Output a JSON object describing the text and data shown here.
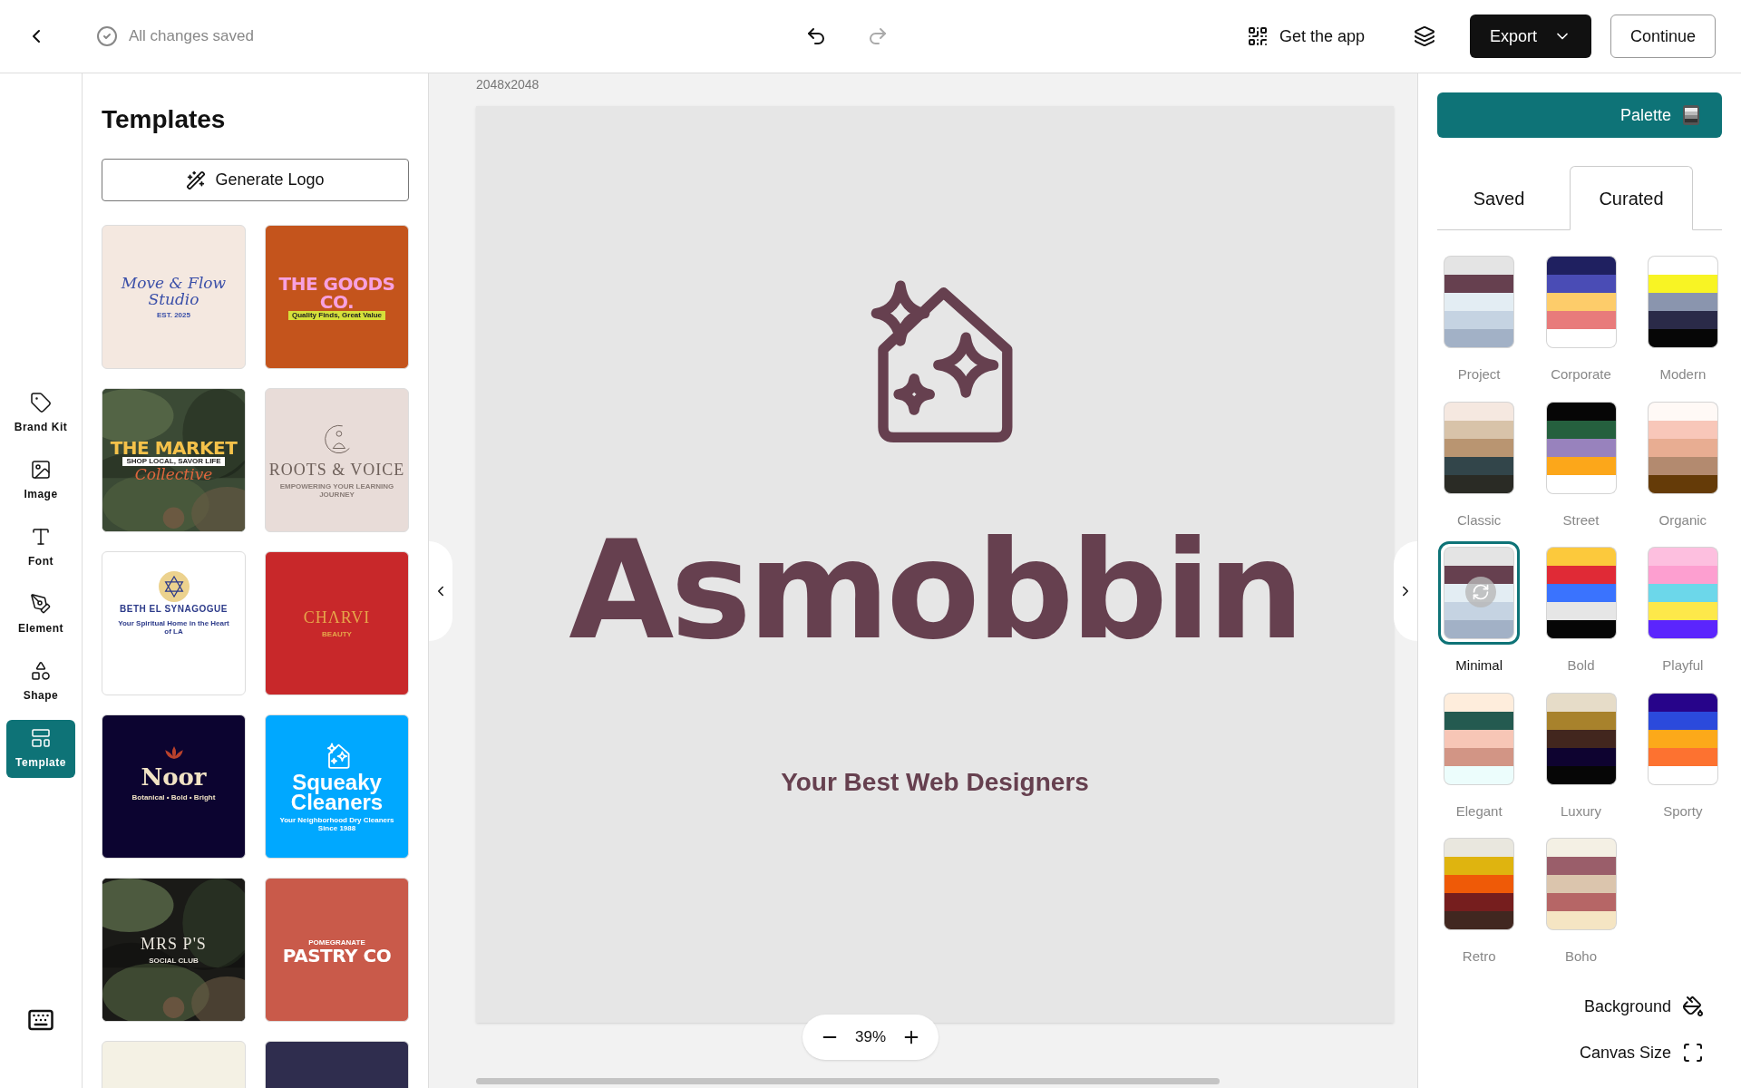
{
  "top_bar": {
    "save_status": "All changes saved",
    "redo_disabled": true,
    "get_app": "Get the app",
    "export": "Export",
    "continue": "Continue"
  },
  "tool_rail": [
    {
      "label": "Brand Kit",
      "selected": false
    },
    {
      "label": "Image",
      "selected": false
    },
    {
      "label": "Font",
      "selected": false
    },
    {
      "label": "Element",
      "selected": false
    },
    {
      "label": "Shape",
      "selected": false
    },
    {
      "label": "Template",
      "selected": true
    }
  ],
  "templates_panel": {
    "title": "Templates",
    "generate_button": "Generate Logo",
    "tiles": [
      {
        "color": "#f4e8e0",
        "lines": [
          {
            "kind": "script",
            "text": "Move & Flow Studio",
            "color": "#3a4fa8"
          },
          {
            "kind": "caption",
            "text": "EST. 2025",
            "color": "#3a4fa8"
          }
        ]
      },
      {
        "color": "#c4541c",
        "lines": [
          {
            "kind": "display",
            "text": "THE GOODS CO.",
            "color": "#f7a1e0"
          },
          {
            "kind": "tag",
            "text": "Quality Finds, Great Value",
            "color": "#d6e03a"
          }
        ]
      },
      {
        "color": "#3b4a35",
        "kind": "picture",
        "lines": [
          {
            "kind": "display",
            "text": "THE MARKET",
            "color": "#f5c24a"
          },
          {
            "kind": "tag",
            "text": "SHOP LOCAL, SAVOR LIFE",
            "color": "#ffffff"
          },
          {
            "kind": "script",
            "text": "Collective",
            "color": "#e0663d"
          }
        ]
      },
      {
        "color": "#e8dcd8",
        "lines": [
          {
            "kind": "serif",
            "text": "ROOTS & VOICE",
            "color": "#6e605a"
          },
          {
            "kind": "caption",
            "text": "EMPOWERING YOUR LEARNING JOURNEY",
            "color": "#8a7d78"
          }
        ]
      },
      {
        "color": "#ffffff",
        "lines": [
          {
            "kind": "heading",
            "text": "BETH EL SYNAGOGUE",
            "color": "#2d3b8a"
          },
          {
            "kind": "caption",
            "text": "Your Spiritual Home in the Heart of LA",
            "color": "#2d3b8a"
          }
        ]
      },
      {
        "color": "#c8282a",
        "lines": [
          {
            "kind": "serif",
            "text": "CHΛRVI",
            "color": "#e6a64a"
          },
          {
            "kind": "caption",
            "text": "BEAUTY",
            "color": "#e6a64a"
          }
        ]
      },
      {
        "color": "#0c0430",
        "lines": [
          {
            "kind": "serif-bold",
            "text": "Noor",
            "color": "#f1e3c4"
          },
          {
            "kind": "caption",
            "text": "Botanical • Bold • Bright",
            "color": "#f1e3c4"
          }
        ]
      },
      {
        "color": "#00a8ff",
        "lines": [
          {
            "kind": "heading-large",
            "text": "Squeaky Cleaners",
            "color": "#ffffff"
          },
          {
            "kind": "caption",
            "text": "Your Neighborhood Dry Cleaners Since 1988",
            "color": "#ffffff"
          }
        ]
      },
      {
        "color": "#1a1a17",
        "kind": "picture",
        "lines": [
          {
            "kind": "serif",
            "text": "MRS P'S",
            "color": "#e8e4dc"
          },
          {
            "kind": "caption",
            "text": "SOCIAL CLUB",
            "color": "#e8e4dc"
          }
        ]
      },
      {
        "color": "#c95a4a",
        "lines": [
          {
            "kind": "caption",
            "text": "POMEGRANATE",
            "color": "#ffffff"
          },
          {
            "kind": "display",
            "text": "PASTRY CO",
            "color": "#ffffff"
          }
        ]
      },
      {
        "color": "#f4f1e4"
      },
      {
        "color": "#2f2d4e"
      }
    ]
  },
  "canvas": {
    "size_label": "2048x2048",
    "title": "Asmobbin",
    "tagline": "Your Best Web Designers",
    "zoom": "39%"
  },
  "palette_panel": {
    "palette_button": "Palette",
    "tabs": [
      {
        "label": "Saved",
        "selected": false
      },
      {
        "label": "Curated",
        "selected": true
      }
    ],
    "palettes": [
      {
        "name": "Project",
        "selected": false,
        "swatches": [
          {
            "color": "#e4e4e4"
          },
          {
            "color": "#66404f"
          },
          {
            "color": "#e3edf3"
          },
          {
            "color": "#c5d3e2"
          },
          {
            "color": "#a2b1c6"
          }
        ]
      },
      {
        "name": "Corporate",
        "selected": false,
        "swatches": [
          {
            "color": "#1f2060"
          },
          {
            "color": "#4a4cb5"
          },
          {
            "color": "#fdcc6a"
          },
          {
            "color": "#e87b7b"
          },
          {
            "color": "#ffffff"
          }
        ]
      },
      {
        "name": "Modern",
        "selected": false,
        "swatches": [
          {
            "color": "#ffffff"
          },
          {
            "color": "#f8f424"
          },
          {
            "color": "#8a95ae"
          },
          {
            "color": "#2a2a48"
          },
          {
            "color": "#060606"
          }
        ]
      },
      {
        "name": "Classic",
        "selected": false,
        "swatches": [
          {
            "color": "#f5e8e0"
          },
          {
            "color": "#d8c3a9"
          },
          {
            "color": "#b99571"
          },
          {
            "color": "#32454a"
          },
          {
            "color": "#2a2b25"
          }
        ]
      },
      {
        "name": "Street",
        "selected": false,
        "swatches": [
          {
            "color": "#060606"
          },
          {
            "color": "#25603e"
          },
          {
            "color": "#9882bd"
          },
          {
            "color": "#fca71a"
          },
          {
            "color": "#ffffff"
          }
        ]
      },
      {
        "name": "Organic",
        "selected": false,
        "swatches": [
          {
            "color": "#fff9f6"
          },
          {
            "color": "#f8c7b9"
          },
          {
            "color": "#e8ad92"
          },
          {
            "color": "#b38a6f"
          },
          {
            "color": "#653b08"
          }
        ]
      },
      {
        "name": "Minimal",
        "selected": true,
        "swatches": [
          {
            "color": "#e4e4e4"
          },
          {
            "color": "#66404f"
          },
          {
            "color": "#e3edf3"
          },
          {
            "color": "#c5d3e2"
          },
          {
            "color": "#a2b1c6"
          }
        ]
      },
      {
        "name": "Bold",
        "selected": false,
        "swatches": [
          {
            "color": "#fcc93c"
          },
          {
            "color": "#e02a36"
          },
          {
            "color": "#3a73fe"
          },
          {
            "color": "#e6e6e6"
          },
          {
            "color": "#060606"
          }
        ]
      },
      {
        "name": "Playful",
        "selected": false,
        "swatches": [
          {
            "color": "#fdbfdf"
          },
          {
            "color": "#fd9fd0"
          },
          {
            "color": "#6cd7ea"
          },
          {
            "color": "#fde84a"
          },
          {
            "color": "#5b25fd"
          }
        ]
      },
      {
        "name": "Elegant",
        "selected": false,
        "swatches": [
          {
            "color": "#feeddc"
          },
          {
            "color": "#245a50"
          },
          {
            "color": "#f7c6b6"
          },
          {
            "color": "#d29585"
          },
          {
            "color": "#ecfdfc"
          }
        ]
      },
      {
        "name": "Luxury",
        "selected": false,
        "swatches": [
          {
            "color": "#e6dcc8"
          },
          {
            "color": "#a8822c"
          },
          {
            "color": "#42261e"
          },
          {
            "color": "#0e0330"
          },
          {
            "color": "#060606"
          }
        ]
      },
      {
        "name": "Sporty",
        "selected": false,
        "swatches": [
          {
            "color": "#27048a"
          },
          {
            "color": "#2b4adc"
          },
          {
            "color": "#fca91a"
          },
          {
            "color": "#fd7230"
          },
          {
            "color": "#ffffff"
          }
        ]
      },
      {
        "name": "Retro",
        "selected": false,
        "swatches": [
          {
            "color": "#e9e7de"
          },
          {
            "color": "#dfb40f"
          },
          {
            "color": "#ef5a07"
          },
          {
            "color": "#761e1e"
          },
          {
            "color": "#412720"
          }
        ]
      },
      {
        "name": "Boho",
        "selected": false,
        "swatches": [
          {
            "color": "#f4f0e4"
          },
          {
            "color": "#9a5e6a"
          },
          {
            "color": "#dbc5ad"
          },
          {
            "color": "#b66666"
          },
          {
            "color": "#f5e5c3"
          }
        ]
      }
    ],
    "background": "Background",
    "canvas_size": "Canvas Size"
  }
}
